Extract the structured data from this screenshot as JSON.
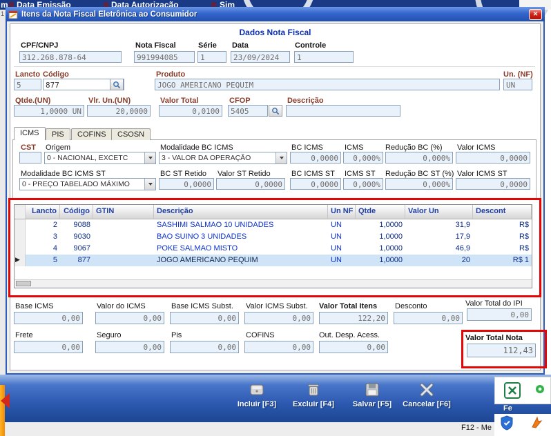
{
  "background": {
    "top_items": [
      "Data Emissão",
      "Data Autorização",
      "Sim"
    ],
    "frag_m": "m",
    "frag_1": "1",
    "f12_hint": "F12 - Me"
  },
  "dialog": {
    "title": "Itens da Nota Fiscal Eletrônica ao Consumidor",
    "section_title": "Dados Nota Fiscal"
  },
  "header_fields": {
    "cpf_cnpj": {
      "label": "CPF/CNPJ",
      "value": "312.268.878-64"
    },
    "nota_fiscal": {
      "label": "Nota Fiscal",
      "value": "991994085"
    },
    "serie": {
      "label": "Série",
      "value": "1"
    },
    "data": {
      "label": "Data",
      "value": "23/09/2024"
    },
    "controle": {
      "label": "Controle",
      "value": "1"
    }
  },
  "item_fields": {
    "lancto": {
      "label": "Lancto",
      "value": "5"
    },
    "codigo": {
      "label": "Código",
      "value": "877"
    },
    "produto": {
      "label": "Produto",
      "value": "JOGO AMERICANO PEQUIM"
    },
    "un_nf": {
      "label": "Un. (NF)",
      "value": "UN"
    },
    "qtde": {
      "label": "Qtde.(UN)",
      "value": "1,0000 UN"
    },
    "vlr_un": {
      "label": "Vlr. Un.(UN)",
      "value": "20,0000"
    },
    "valor_total": {
      "label": "Valor Total",
      "value": "0,0100"
    },
    "cfop": {
      "label": "CFOP",
      "value": "5405"
    },
    "descricao": {
      "label": "Descrição",
      "value": ""
    }
  },
  "tabs": {
    "t0": "ICMS",
    "t1": "PIS",
    "t2": "COFINS",
    "t3": "CSOSN",
    "active": "ICMS"
  },
  "icms": {
    "cst": {
      "label": "CST",
      "value": ""
    },
    "origem": {
      "label": "Origem",
      "value": "0 - NACIONAL, EXCETC"
    },
    "modalidade_bc": {
      "label": "Modalidade BC ICMS",
      "value": "3 - VALOR DA OPERAÇÃO"
    },
    "bc_icms": {
      "label": "BC ICMS",
      "value": "0,0000"
    },
    "icms": {
      "label": "ICMS",
      "value": "0,000%"
    },
    "reducao_bc": {
      "label": "Redução BC (%)",
      "value": "0,000%"
    },
    "valor_icms": {
      "label": "Valor ICMS",
      "value": "0,0000"
    },
    "modalidade_bc_st": {
      "label": "Modalidade BC ICMS ST",
      "value": "0 - PREÇO TABELADO MÁXIMO"
    },
    "bc_st_retido": {
      "label": "BC ST Retido",
      "value": "0,0000"
    },
    "valor_st_retido": {
      "label": "Valor ST Retido",
      "value": "0,0000"
    },
    "bc_icms_st": {
      "label": "BC ICMS ST",
      "value": "0,0000"
    },
    "icms_st": {
      "label": "ICMS ST",
      "value": "0,000%"
    },
    "reducao_bc_st": {
      "label": "Redução BC ST (%)",
      "value": "0,000%"
    },
    "valor_icms_st": {
      "label": "Valor ICMS ST",
      "value": "0,0000"
    }
  },
  "grid": {
    "columns": [
      "Lancto",
      "Código",
      "GTIN",
      "Descrição",
      "Un NF",
      "Qtde",
      "Valor Un",
      "Descont"
    ],
    "rows": [
      {
        "lancto": "2",
        "codigo": "9088",
        "gtin": "",
        "descricao": "SASHIMI SALMAO 10 UNIDADES",
        "un": "UN",
        "qtde": "1,0000",
        "valor_un": "31,9",
        "desconto": "R$"
      },
      {
        "lancto": "3",
        "codigo": "9030",
        "gtin": "",
        "descricao": "BAO SUINO 3 UNIDADES",
        "un": "UN",
        "qtde": "1,0000",
        "valor_un": "17,9",
        "desconto": "R$"
      },
      {
        "lancto": "4",
        "codigo": "9067",
        "gtin": "",
        "descricao": "POKE SALMAO MISTO",
        "un": "UN",
        "qtde": "1,0000",
        "valor_un": "46,9",
        "desconto": "R$"
      },
      {
        "lancto": "5",
        "codigo": "877",
        "gtin": "",
        "descricao": "JOGO AMERICANO PEQUIM",
        "un": "UN",
        "qtde": "1,0000",
        "valor_un": "20",
        "desconto": "R$ 1"
      }
    ],
    "selected_index": 3
  },
  "totals": {
    "base_icms": {
      "label": "Base ICMS",
      "value": "0,00"
    },
    "valor_do_icms": {
      "label": "Valor do ICMS",
      "value": "0,00"
    },
    "base_icms_subst": {
      "label": "Base ICMS Subst.",
      "value": "0,00"
    },
    "valor_icms_subst": {
      "label": "Valor ICMS Subst.",
      "value": "0,00"
    },
    "valor_total_itens": {
      "label": "Valor Total Itens",
      "value": "122,20"
    },
    "desconto": {
      "label": "Desconto",
      "value": "0,00"
    },
    "valor_total_ipi": {
      "label": "Valor Total do IPI",
      "value": "0,00"
    },
    "frete": {
      "label": "Frete",
      "value": "0,00"
    },
    "seguro": {
      "label": "Seguro",
      "value": "0,00"
    },
    "pis": {
      "label": "Pis",
      "value": "0,00"
    },
    "cofins": {
      "label": "COFINS",
      "value": "0,00"
    },
    "out_desp": {
      "label": "Out. Desp. Acess.",
      "value": "0,00"
    },
    "valor_total_nota": {
      "label": "Valor Total Nota",
      "value": "112,43"
    }
  },
  "toolbar": {
    "incluir": "Incluir [F3]",
    "excluir": "Excluir [F4]",
    "salvar": "Salvar [F5]",
    "cancelar": "Cancelar [F6]",
    "fechar": "Fe"
  },
  "icons": {
    "row_marker": "▶",
    "close": "✕"
  },
  "colors": {
    "titlebar_blue": "#3566cc",
    "annotation_red": "#e60505",
    "selection_blue": "#cfe4f7",
    "grid_text_blue": "#0a30cf",
    "label_maroon": "#8a3a28",
    "footer_blue": "#2a57ad"
  }
}
